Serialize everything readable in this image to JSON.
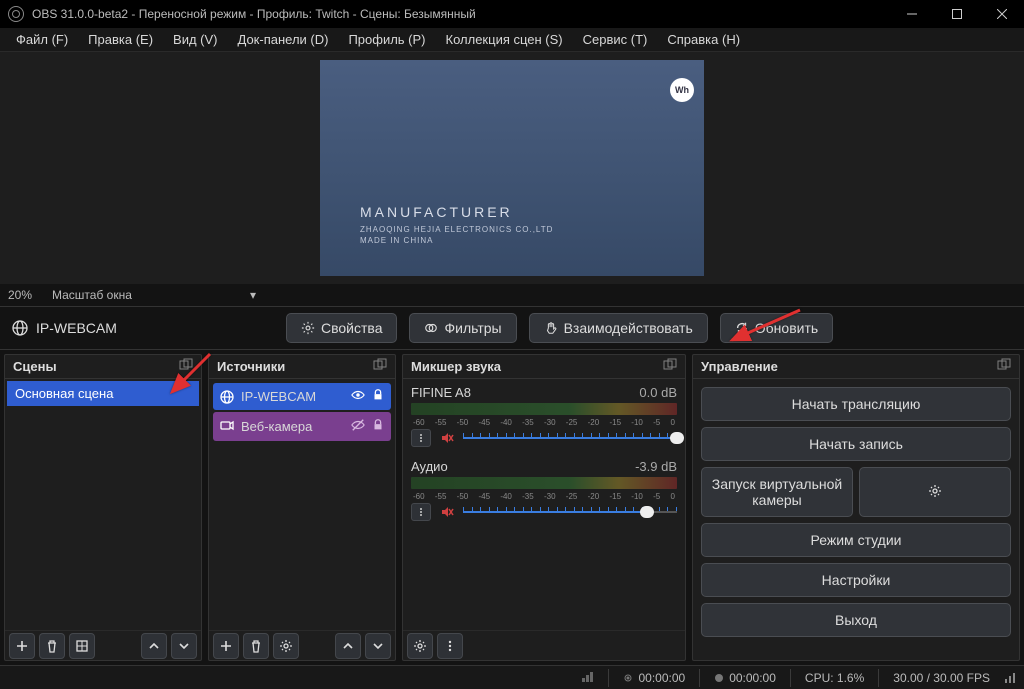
{
  "titlebar": "OBS 31.0.0-beta2 - Переносной режим - Профиль: Twitch - Сцены: Безымянный",
  "menu": [
    "Файл (F)",
    "Правка (E)",
    "Вид (V)",
    "Док-панели (D)",
    "Профиль (P)",
    "Коллекция сцен (S)",
    "Сервис (T)",
    "Справка (H)"
  ],
  "preview": {
    "line1": "MANUFACTURER",
    "line2": "ZHAOQING HEJIA ELECTRONICS CO.,LTD",
    "line3": "MADE IN CHINA",
    "logo": "Wh"
  },
  "zoom": {
    "pct": "20%",
    "label": "Масштаб окна"
  },
  "context": {
    "source_name": "IP-WEBCAM",
    "properties": "Свойства",
    "filters": "Фильтры",
    "interact": "Взаимодействовать",
    "refresh": "Обновить"
  },
  "docks": {
    "scenes": {
      "title": "Сцены",
      "items": [
        "Основная сцена"
      ]
    },
    "sources": {
      "title": "Источники",
      "items": [
        {
          "name": "IP-WEBCAM",
          "selected": true,
          "visible": true,
          "locked": true,
          "type": "globe"
        },
        {
          "name": "Веб-камера",
          "selected": false,
          "visible": false,
          "locked": true,
          "type": "camera"
        }
      ]
    },
    "mixer": {
      "title": "Микшер звука",
      "channels": [
        {
          "name": "FIFINE A8",
          "db": "0.0 dB",
          "fill": 100
        },
        {
          "name": "Аудио",
          "db": "-3.9 dB",
          "fill": 86
        }
      ],
      "ticks": [
        "-60",
        "-55",
        "-50",
        "-45",
        "-40",
        "-35",
        "-30",
        "-25",
        "-20",
        "-15",
        "-10",
        "-5",
        "0"
      ]
    },
    "controls": {
      "title": "Управление",
      "buttons": {
        "stream": "Начать трансляцию",
        "record": "Начать запись",
        "vcam": "Запуск виртуальной камеры",
        "studio": "Режим студии",
        "settings": "Настройки",
        "exit": "Выход"
      }
    }
  },
  "status": {
    "live_time": "00:00:00",
    "rec_time": "00:00:00",
    "cpu": "CPU: 1.6%",
    "fps": "30.00 / 30.00 FPS"
  }
}
